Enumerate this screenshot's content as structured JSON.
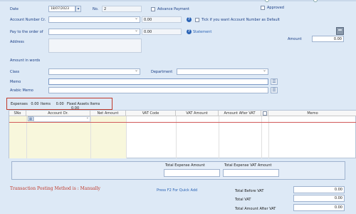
{
  "top": {
    "date_label": "Date",
    "date_value": "18/07/2023",
    "no_label": "No.",
    "no_value": "2",
    "advance_payment_label": "Advance Payment",
    "approved_label": "Approved"
  },
  "form": {
    "account_number_label": "Account Number Cr.",
    "account_amount": "0.00",
    "tick_default_label": "Tick if you want Account Number as Default",
    "pay_to_label": "Pay to the order of",
    "pay_to_amount": "0.00",
    "statement_label": "Statement",
    "address_label": "Address",
    "amount_label": "Amount",
    "amount_value": "0.00",
    "amount_in_words_label": "Amount in words",
    "class_label": "Class",
    "department_label": "Department",
    "memo_label": "Memo",
    "arabic_memo_label": "Arabic Memo"
  },
  "tabs": {
    "expenses_label": "Expenses",
    "expenses_value": "0.00",
    "items_label": "Items",
    "items_value": "0.00",
    "fixed_assets_label": "Fixed Assets Items",
    "fixed_assets_value": "0.00"
  },
  "grid": {
    "columns": [
      "SNo",
      "Account Dr.",
      "Net Amount",
      "VAT Code",
      "VAT Amount",
      "Amount After VAT",
      "",
      "Memo"
    ]
  },
  "summary": {
    "total_expense_amount_label": "Total Expense Amount",
    "total_expense_vat_amount_label": "Total Expense VAT Amount",
    "posting_method": "Transaction Posting Method is : Manually",
    "quick_add_hint": "Press F2 For Quick Add",
    "total_before_vat_label": "Total Before VAT",
    "total_before_vat_value": "0.00",
    "total_vat_label": "Total VAT",
    "total_vat_value": "0.00",
    "total_amount_after_vat_label": "Total Amount After VAT",
    "total_amount_after_vat_value": "0.00"
  },
  "colors": {
    "background": "#dde9f6",
    "label": "#1b3f86",
    "highlight_border": "#c0392b",
    "posting_text": "#c0392b"
  }
}
